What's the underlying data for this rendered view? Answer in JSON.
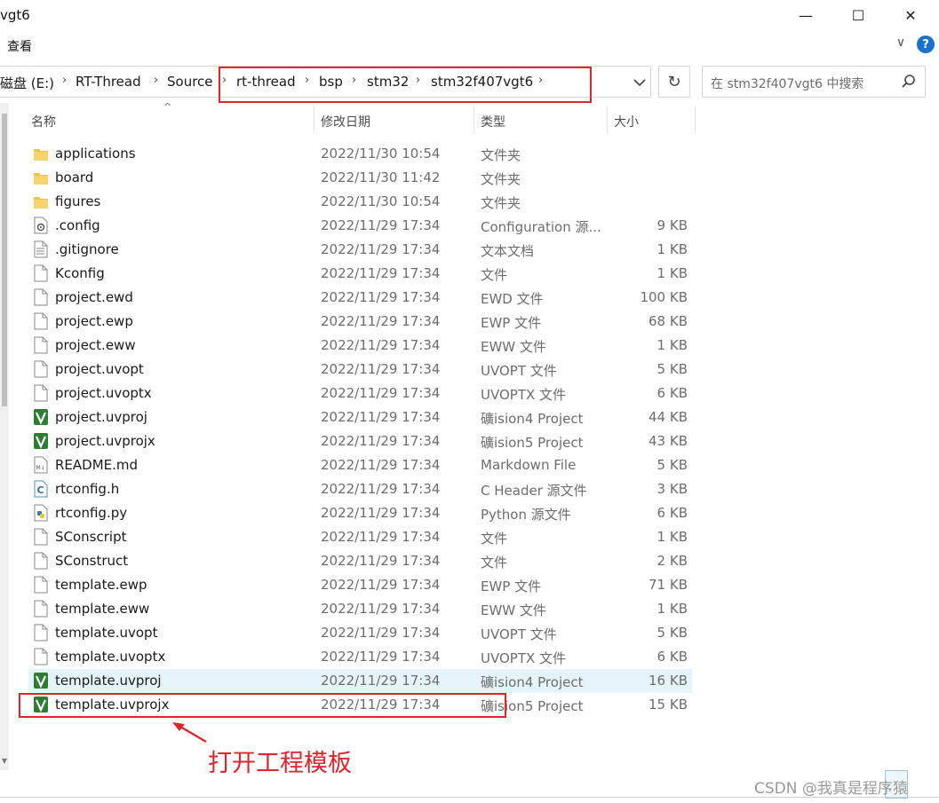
{
  "window": {
    "title": "vgt6",
    "minimize_glyph": "—",
    "maximize_glyph": "☐",
    "close_glyph": "✕"
  },
  "ribbon": {
    "tab": "查看",
    "help_glyph": "?",
    "collapse_glyph": "∨"
  },
  "address": {
    "crumbs": [
      "磁盘 (E:)",
      "RT-Thread",
      "Source",
      "rt-thread",
      "bsp",
      "stm32",
      "stm32f407vgt6"
    ],
    "refresh_glyph": "↻"
  },
  "search": {
    "placeholder": "在 stm32f407vgt6 中搜索"
  },
  "columns": {
    "name": "名称",
    "date": "修改日期",
    "type": "类型",
    "size": "大小"
  },
  "files": [
    {
      "name": "applications",
      "date": "2022/11/30 10:54",
      "type": "文件夹",
      "size": "",
      "icon": "folder-icon"
    },
    {
      "name": "board",
      "date": "2022/11/30 11:42",
      "type": "文件夹",
      "size": "",
      "icon": "folder-icon"
    },
    {
      "name": "figures",
      "date": "2022/11/30 10:54",
      "type": "文件夹",
      "size": "",
      "icon": "folder-icon"
    },
    {
      "name": ".config",
      "date": "2022/11/29 17:34",
      "type": "Configuration 源...",
      "size": "9 KB",
      "icon": "config-file-icon"
    },
    {
      "name": ".gitignore",
      "date": "2022/11/29 17:34",
      "type": "文本文档",
      "size": "1 KB",
      "icon": "text-file-icon"
    },
    {
      "name": "Kconfig",
      "date": "2022/11/29 17:34",
      "type": "文件",
      "size": "1 KB",
      "icon": "file-icon"
    },
    {
      "name": "project.ewd",
      "date": "2022/11/29 17:34",
      "type": "EWD 文件",
      "size": "100 KB",
      "icon": "file-icon"
    },
    {
      "name": "project.ewp",
      "date": "2022/11/29 17:34",
      "type": "EWP 文件",
      "size": "68 KB",
      "icon": "file-icon"
    },
    {
      "name": "project.eww",
      "date": "2022/11/29 17:34",
      "type": "EWW 文件",
      "size": "1 KB",
      "icon": "file-icon"
    },
    {
      "name": "project.uvopt",
      "date": "2022/11/29 17:34",
      "type": "UVOPT 文件",
      "size": "5 KB",
      "icon": "file-icon"
    },
    {
      "name": "project.uvoptx",
      "date": "2022/11/29 17:34",
      "type": "UVOPTX 文件",
      "size": "6 KB",
      "icon": "file-icon"
    },
    {
      "name": "project.uvproj",
      "date": "2022/11/29 17:34",
      "type": "礦ision4 Project",
      "size": "44 KB",
      "icon": "keil-project-icon"
    },
    {
      "name": "project.uvprojx",
      "date": "2022/11/29 17:34",
      "type": "礦ision5 Project",
      "size": "43 KB",
      "icon": "keil-project-icon"
    },
    {
      "name": "README.md",
      "date": "2022/11/29 17:34",
      "type": "Markdown File",
      "size": "5 KB",
      "icon": "markdown-file-icon"
    },
    {
      "name": "rtconfig.h",
      "date": "2022/11/29 17:34",
      "type": "C Header 源文件",
      "size": "3 KB",
      "icon": "c-header-file-icon"
    },
    {
      "name": "rtconfig.py",
      "date": "2022/11/29 17:34",
      "type": "Python 源文件",
      "size": "6 KB",
      "icon": "python-file-icon"
    },
    {
      "name": "SConscript",
      "date": "2022/11/29 17:34",
      "type": "文件",
      "size": "1 KB",
      "icon": "file-icon"
    },
    {
      "name": "SConstruct",
      "date": "2022/11/29 17:34",
      "type": "文件",
      "size": "2 KB",
      "icon": "file-icon"
    },
    {
      "name": "template.ewp",
      "date": "2022/11/29 17:34",
      "type": "EWP 文件",
      "size": "71 KB",
      "icon": "file-icon"
    },
    {
      "name": "template.eww",
      "date": "2022/11/29 17:34",
      "type": "EWW 文件",
      "size": "1 KB",
      "icon": "file-icon"
    },
    {
      "name": "template.uvopt",
      "date": "2022/11/29 17:34",
      "type": "UVOPT 文件",
      "size": "5 KB",
      "icon": "file-icon"
    },
    {
      "name": "template.uvoptx",
      "date": "2022/11/29 17:34",
      "type": "UVOPTX 文件",
      "size": "6 KB",
      "icon": "file-icon"
    },
    {
      "name": "template.uvproj",
      "date": "2022/11/29 17:34",
      "type": "礦ision4 Project",
      "size": "16 KB",
      "icon": "keil-project-icon",
      "selected": true
    },
    {
      "name": "template.uvprojx",
      "date": "2022/11/29 17:34",
      "type": "礦ision5 Project",
      "size": "15 KB",
      "icon": "keil-project-icon"
    }
  ],
  "annotation": {
    "text": "打开工程模板"
  },
  "watermark": {
    "text": "CSDN @我真是程序猿"
  },
  "colors": {
    "highlight": "#e0242b",
    "folder": "#f2c14e",
    "keil": "#2e7d32",
    "selected_row": "#e5f3fb",
    "accent": "#1a73c8"
  }
}
